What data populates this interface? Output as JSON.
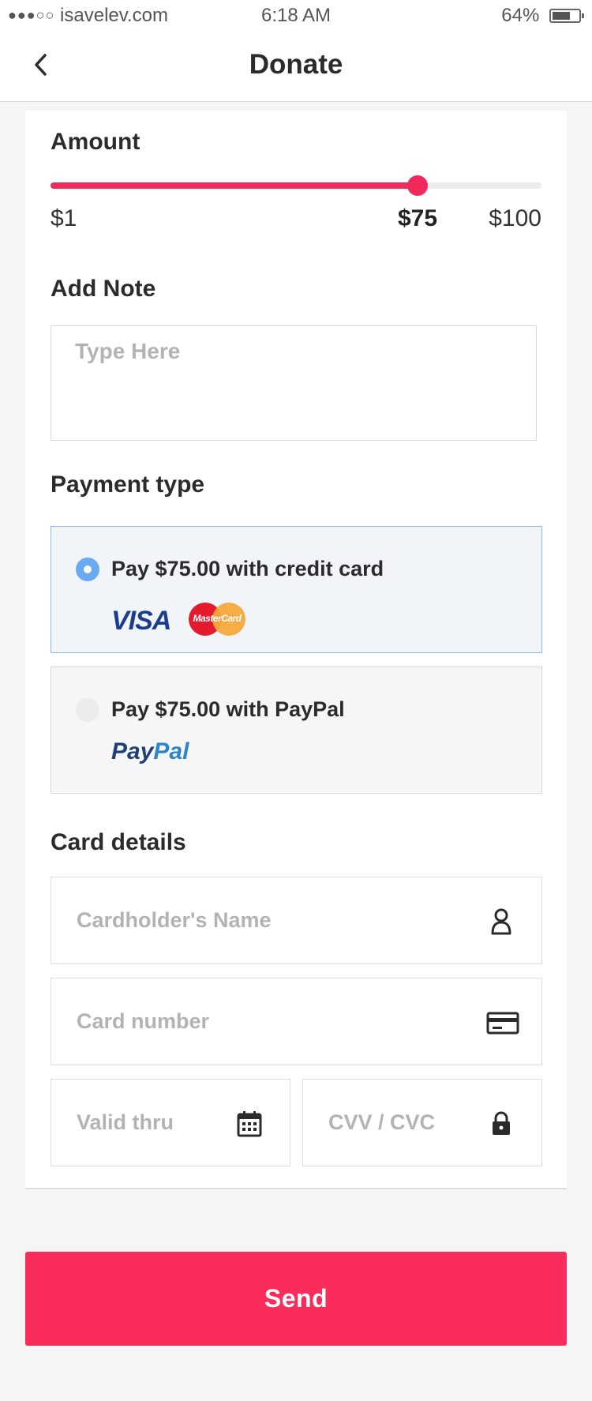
{
  "status_bar": {
    "signal_dots": "●●●○○",
    "carrier": "isavelev.com",
    "time": "6:18 AM",
    "battery": "64%"
  },
  "header": {
    "title": "Donate",
    "back_icon": "chevron-left-icon"
  },
  "amount": {
    "title": "Amount",
    "min_label": "$1",
    "current_label": "$75",
    "max_label": "$100",
    "min": 1,
    "max": 100,
    "value": 75,
    "accent_color": "#f2295b"
  },
  "note": {
    "title": "Add Note",
    "placeholder": "Type Here",
    "value": ""
  },
  "payment": {
    "title": "Payment type",
    "options": [
      {
        "label": "Pay $75.00 with credit card",
        "selected": true,
        "logos": [
          "VISA",
          "MasterCard"
        ]
      },
      {
        "label": "Pay $75.00 with PayPal",
        "selected": false,
        "logos": [
          "PayPal"
        ]
      }
    ],
    "visa_text": "VISA",
    "mastercard_text": "MasterCard",
    "paypal_pay": "Pay",
    "paypal_pal": "Pal",
    "selected_color": "#6aaaf2"
  },
  "card_details": {
    "title": "Card details",
    "name_placeholder": "Cardholder's Name",
    "number_placeholder": "Card number",
    "valid_placeholder": "Valid thru",
    "cvv_placeholder": "CVV / CVC",
    "icons": [
      "user-icon",
      "credit-card-icon",
      "calendar-icon",
      "lock-icon"
    ]
  },
  "send_button": {
    "label": "Send",
    "color": "#f92c5c"
  }
}
